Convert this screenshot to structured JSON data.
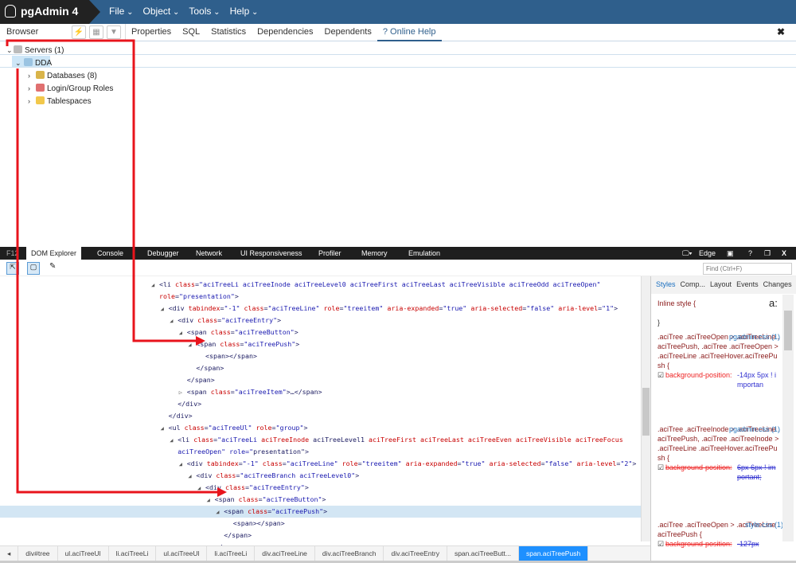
{
  "app": {
    "title": "pgAdmin 4",
    "menu": [
      "File",
      "Object",
      "Tools",
      "Help"
    ]
  },
  "browser": {
    "label": "Browser",
    "tabs": [
      "Properties",
      "SQL",
      "Statistics",
      "Dependencies",
      "Dependents",
      "? Online Help"
    ],
    "active_tab": "? Online Help",
    "close": "✖"
  },
  "tree": [
    {
      "label": "Servers (1)",
      "icon": "server-icon"
    },
    {
      "label": "DDA",
      "icon": "elephant-icon"
    },
    {
      "label": "Databases (8)",
      "icon": "database-icon"
    },
    {
      "label": "Login/Group Roles",
      "icon": "roles-icon"
    },
    {
      "label": "Tablespaces",
      "icon": "folder-icon"
    }
  ],
  "devtools": {
    "f12": "F12",
    "tabs": [
      "DOM Explorer",
      "Console",
      "Debugger",
      "Network",
      "UI Responsiveness",
      "Profiler",
      "Memory",
      "Emulation"
    ],
    "active_tab": "DOM Explorer",
    "mode": "Edge",
    "find_placeholder": "Find (Ctrl+F)",
    "dom_lines": [
      {
        "level": 0,
        "exp": "open",
        "text": "<li class=\"aciTreeLi aciTreeInode aciTreeLevel0 aciTreeFirst aciTreeLast aciTreeVisible aciTreeOdd aciTreeOpen\""
      },
      {
        "level": 0,
        "exp": "none",
        "text": "role=\"presentation\">"
      },
      {
        "level": 1,
        "exp": "open",
        "text": "<div tabindex=\"-1\" class=\"aciTreeLine\" role=\"treeitem\" aria-expanded=\"true\" aria-selected=\"false\" aria-level=\"1\">"
      },
      {
        "level": 2,
        "exp": "open",
        "text": "<div class=\"aciTreeEntry\">"
      },
      {
        "level": 3,
        "exp": "open",
        "text": "<span class=\"aciTreeButton\">"
      },
      {
        "level": 4,
        "exp": "open",
        "text": "<span class=\"aciTreePush\">"
      },
      {
        "level": 5,
        "exp": "none",
        "text": "<span></span>"
      },
      {
        "level": 4,
        "exp": "none",
        "text": "</span>"
      },
      {
        "level": 3,
        "exp": "none",
        "text": "</span>"
      },
      {
        "level": 3,
        "exp": "closed",
        "text": "<span class=\"aciTreeItem\">…</span>"
      },
      {
        "level": 2,
        "exp": "none",
        "text": "</div>"
      },
      {
        "level": 1,
        "exp": "none",
        "text": "</div>"
      },
      {
        "level": 1,
        "exp": "open",
        "text": "<ul class=\"aciTreeUl\" role=\"group\">"
      },
      {
        "level": 2,
        "exp": "open",
        "text": "<li class=\"aciTreeLi aciTreeInode aciTreeLevel1 aciTreeFirst aciTreeLast aciTreeEven aciTreeVisible aciTreeFocus"
      },
      {
        "level": 2,
        "exp": "none",
        "text": "aciTreeOpen\" role=\"presentation\">"
      },
      {
        "level": 3,
        "exp": "open",
        "text": "<div tabindex=\"-1\" class=\"aciTreeLine\" role=\"treeitem\" aria-expanded=\"true\" aria-selected=\"false\" aria-level=\"2\">"
      },
      {
        "level": 4,
        "exp": "open",
        "text": "<div class=\"aciTreeBranch aciTreeLevel0\">"
      },
      {
        "level": 5,
        "exp": "open",
        "text": "<div class=\"aciTreeEntry\">"
      },
      {
        "level": 6,
        "exp": "open",
        "text": "<span class=\"aciTreeButton\">"
      },
      {
        "level": 7,
        "exp": "open",
        "text": "<span class=\"aciTreePush\">",
        "selected": true
      },
      {
        "level": 8,
        "exp": "none",
        "text": "<span></span>"
      },
      {
        "level": 7,
        "exp": "none",
        "text": "</span>"
      },
      {
        "level": 6,
        "exp": "none",
        "text": "</span>"
      },
      {
        "level": 5,
        "exp": "closed",
        "text": "<span class=\"aciTreeItem\">…</span>"
      },
      {
        "level": 4,
        "exp": "none",
        "text": "</div>"
      }
    ],
    "styles_tabs": [
      "Styles",
      "Comp...",
      "Layout",
      "Events",
      "Changes"
    ],
    "styles": {
      "inline": "Inline style  {",
      "inline_close": "}",
      "pseudo": "a:",
      "rules": [
        {
          "selector": ".aciTree .aciTreeOpen > .aciTreeLine .aciTreePush, .aciTree .aciTreeOpen > .aciTreeLine .aciTreeHover.aciTreePush  {",
          "source": "pgadmin.css (1)",
          "property": "background-position:",
          "value": "-14px 5px ! importan",
          "struck": false
        },
        {
          "selector": ".aciTree .aciTreeInode > .aciTreeLine .aciTreePush, .aciTree .aciTreeInode > .aciTreeLine .aciTreeHover.aciTreePush  {",
          "source": "pgadmin.css (1)",
          "property": "background-position:",
          "value": "6px 6px ! important;",
          "struck": true
        },
        {
          "selector": ".aciTree .aciTreeOpen > .aciTreeLine .aciTreePush  {",
          "source": "style.css (1)",
          "property": "background-position:",
          "value": "-127px",
          "struck": true
        }
      ]
    },
    "breadcrumb": [
      "div#tree",
      "ul.aciTreeUl",
      "li.aciTreeLi",
      "ul.aciTreeUl",
      "li.aciTreeLi",
      "div.aciTreeLine",
      "div.aciTreeBranch",
      "div.aciTreeEntry",
      "span.aciTreeButt...",
      "span.aciTreePush"
    ]
  },
  "colors": {
    "header": "#2f5f8c",
    "annotation": "#e8141c",
    "selection": "#d3e6f4"
  }
}
